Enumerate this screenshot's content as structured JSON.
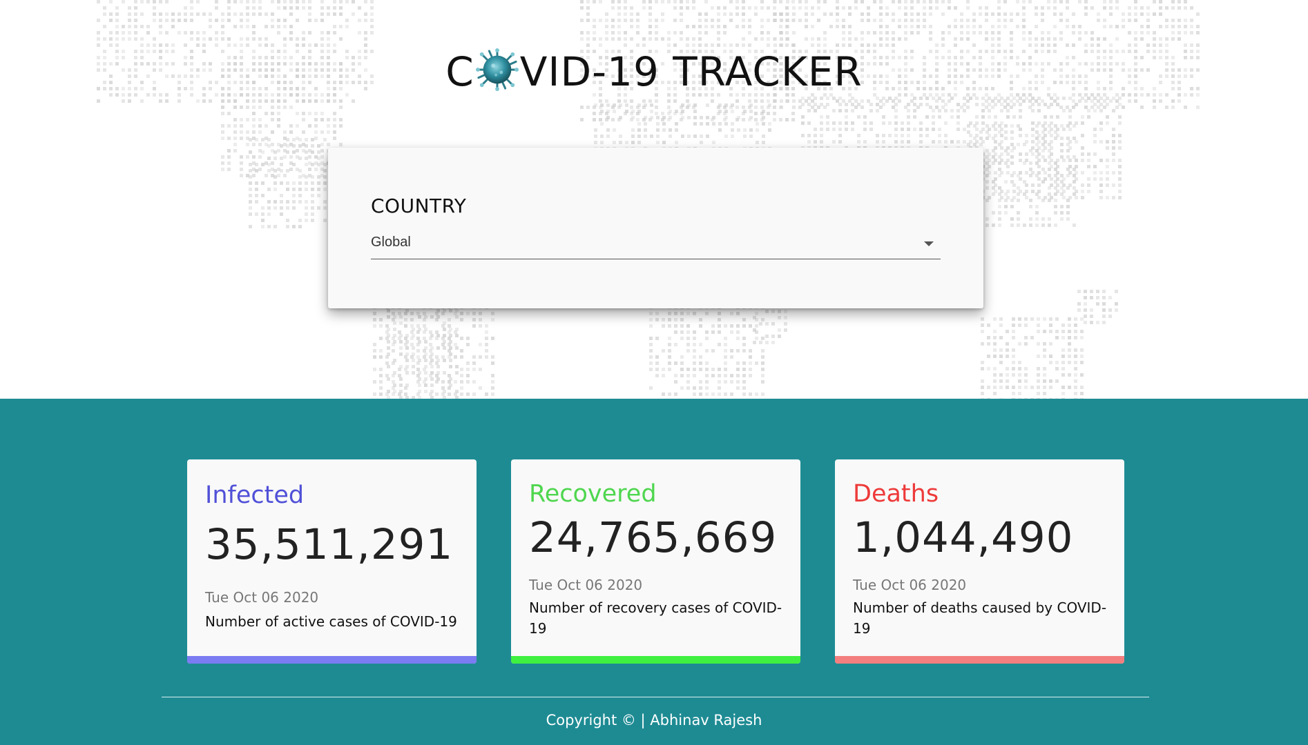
{
  "header": {
    "title_left": "C",
    "title_right": "VID-19 TRACKER",
    "virus_icon": "coronavirus-icon"
  },
  "country_picker": {
    "label": "COUNTRY",
    "selected": "Global",
    "icon": "caret-down-icon"
  },
  "cards": [
    {
      "label": "Infected",
      "value": "35,511,291",
      "date": "Tue Oct 06 2020",
      "description": "Number of active cases of COVID-19",
      "color": "#5050d8",
      "bar_color": "#7b7bf2"
    },
    {
      "label": "Recovered",
      "value": "24,765,669",
      "date": "Tue Oct 06 2020",
      "description": "Number of recovery cases of COVID-19",
      "color": "#4fd64f",
      "bar_color": "#40f040"
    },
    {
      "label": "Deaths",
      "value": "1,044,490",
      "date": "Tue Oct 06 2020",
      "description": "Number of deaths caused by COVID-19",
      "color": "#ee3a3a",
      "bar_color": "#f47f7f"
    }
  ],
  "footer": {
    "copyright": "Copyright © | Abhinav Rajesh"
  },
  "colors": {
    "teal_background": "#1e8b93",
    "card_background": "#f9f9f9"
  }
}
